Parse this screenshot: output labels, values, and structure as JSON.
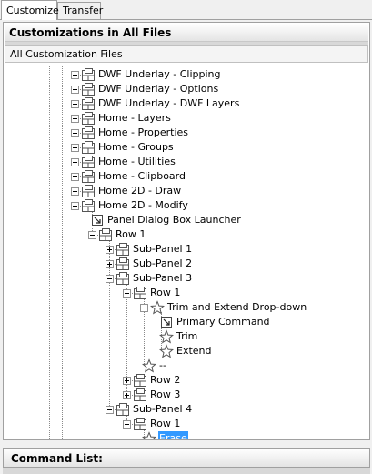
{
  "tabs": [
    {
      "label": "Customize",
      "active": true
    },
    {
      "label": "Transfer",
      "active": false
    }
  ],
  "customizations_panel": {
    "header": "Customizations in All Files",
    "dropdown_value": "All Customization Files"
  },
  "tree_items": [
    {
      "label": "DWF Underlay - Clipping",
      "icon": "panel-icon",
      "expander": "plus",
      "depth": 0
    },
    {
      "label": "DWF Underlay - Options",
      "icon": "panel-icon",
      "expander": "plus",
      "depth": 0
    },
    {
      "label": "DWF Underlay - DWF Layers",
      "icon": "panel-icon",
      "expander": "plus",
      "depth": 0
    },
    {
      "label": "Home - Layers",
      "icon": "panel-icon",
      "expander": "plus",
      "depth": 0
    },
    {
      "label": "Home - Properties",
      "icon": "panel-icon",
      "expander": "plus",
      "depth": 0
    },
    {
      "label": "Home - Groups",
      "icon": "panel-icon",
      "expander": "plus",
      "depth": 0
    },
    {
      "label": "Home - Utilities",
      "icon": "panel-icon",
      "expander": "plus",
      "depth": 0
    },
    {
      "label": "Home - Clipboard",
      "icon": "panel-icon",
      "expander": "plus",
      "depth": 0
    },
    {
      "label": "Home 2D - Draw",
      "icon": "panel-icon",
      "expander": "plus",
      "depth": 0
    },
    {
      "label": "Home 2D - Modify",
      "icon": "panel-icon",
      "expander": "minus",
      "depth": 0
    },
    {
      "label": "Panel Dialog Box Launcher",
      "icon": "launcher-icon",
      "expander": "none",
      "depth": 1
    },
    {
      "label": "Row 1",
      "icon": "row-icon",
      "expander": "minus",
      "depth": 1
    },
    {
      "label": "Sub-Panel 1",
      "icon": "row-icon",
      "expander": "plus",
      "depth": 2
    },
    {
      "label": "Sub-Panel 2",
      "icon": "row-icon",
      "expander": "plus",
      "depth": 2
    },
    {
      "label": "Sub-Panel 3",
      "icon": "row-icon",
      "expander": "minus",
      "depth": 2
    },
    {
      "label": "Row 1",
      "icon": "row-icon",
      "expander": "minus",
      "depth": 3
    },
    {
      "label": "Trim and Extend Drop-down",
      "icon": "star-icon",
      "expander": "minus",
      "depth": 4
    },
    {
      "label": "Primary Command",
      "icon": "launcher-icon",
      "expander": "none",
      "depth": 5
    },
    {
      "label": "Trim",
      "icon": "star-icon",
      "expander": "none",
      "depth": 5
    },
    {
      "label": "Extend",
      "icon": "star-icon",
      "expander": "none",
      "depth": 5
    },
    {
      "label": "--",
      "icon": "star-icon",
      "expander": "none",
      "depth": 4
    },
    {
      "label": "Row 2",
      "icon": "row-icon",
      "expander": "plus",
      "depth": 3
    },
    {
      "label": "Row 3",
      "icon": "row-icon",
      "expander": "plus",
      "depth": 3
    },
    {
      "label": "Sub-Panel 4",
      "icon": "row-icon",
      "expander": "minus",
      "depth": 2
    },
    {
      "label": "Row 1",
      "icon": "row-icon",
      "expander": "minus",
      "depth": 3
    },
    {
      "label": "Erase",
      "icon": "star-icon",
      "expander": "none",
      "depth": 4,
      "selected": true
    }
  ],
  "command_list": {
    "header": "Command List:"
  }
}
